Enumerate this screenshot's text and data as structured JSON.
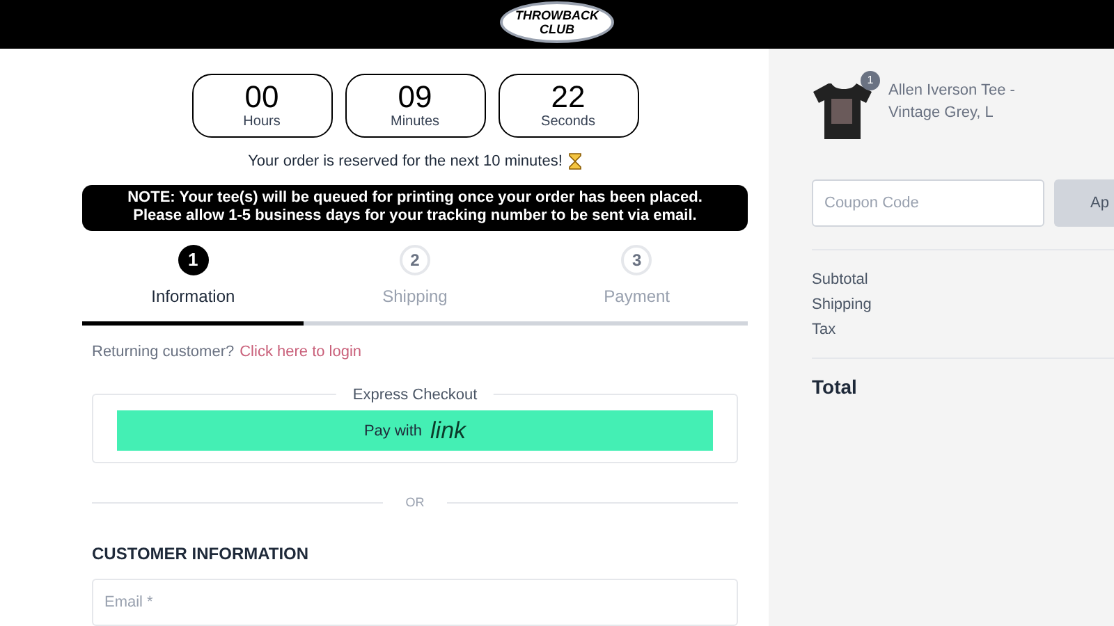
{
  "header": {
    "logo": [
      "THROWBACK",
      "CLUB"
    ]
  },
  "timer": [
    {
      "value": "00",
      "unit": "Hours"
    },
    {
      "value": "09",
      "unit": "Minutes"
    },
    {
      "value": "22",
      "unit": "Seconds"
    }
  ],
  "reserve_note": "Your order is reserved for the next 10 minutes!",
  "notice": "NOTE: Your tee(s) will be queued for printing once your order has been placed. Please allow 1-5 business days for your tracking number to be sent via email.",
  "steps": [
    {
      "number": "1",
      "label": "Information",
      "selected": true
    },
    {
      "number": "2",
      "label": "Shipping",
      "selected": false
    },
    {
      "number": "3",
      "label": "Payment",
      "selected": false
    }
  ],
  "returning": {
    "text": "Returning customer?",
    "link": "Click here to login"
  },
  "express": {
    "title": "Express Checkout",
    "button_text": "Pay with",
    "button_brand": "link"
  },
  "divider_text": "OR",
  "customer_section": {
    "title": "CUSTOMER INFORMATION",
    "email_placeholder": "Email *"
  },
  "cart": {
    "items": [
      {
        "name": "Allen Iverson Tee - Vintage Grey, L",
        "quantity": "1"
      }
    ],
    "coupon_placeholder": "Coupon Code",
    "apply_button": "Ap",
    "summary": [
      "Subtotal",
      "Shipping",
      "Tax"
    ],
    "total_label": "Total"
  }
}
